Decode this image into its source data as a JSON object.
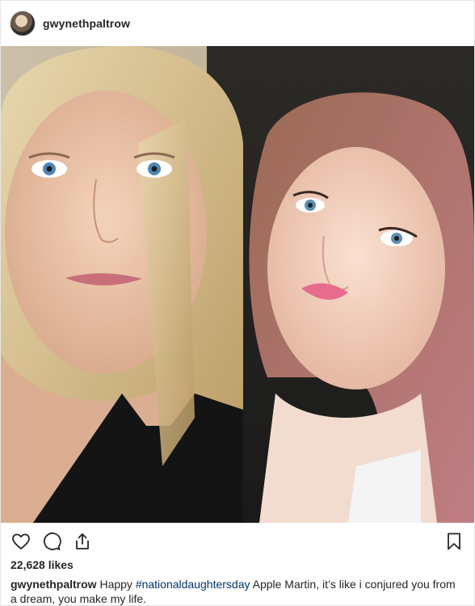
{
  "header": {
    "username": "gwynethpaltrow"
  },
  "actions": {
    "like_icon": "heart-icon",
    "comment_icon": "comment-icon",
    "share_icon": "share-icon",
    "save_icon": "bookmark-icon"
  },
  "likes": {
    "text": "22,628 likes"
  },
  "caption": {
    "username": "gwynethpaltrow",
    "text_before": " Happy ",
    "hashtag": "#nationaldaughtersday",
    "text_after": " Apple Martin, it’s like i conjured you from a dream, you make my life."
  },
  "colors": {
    "text": "#262626",
    "hashtag": "#003569",
    "border": "#e6e6e6"
  }
}
